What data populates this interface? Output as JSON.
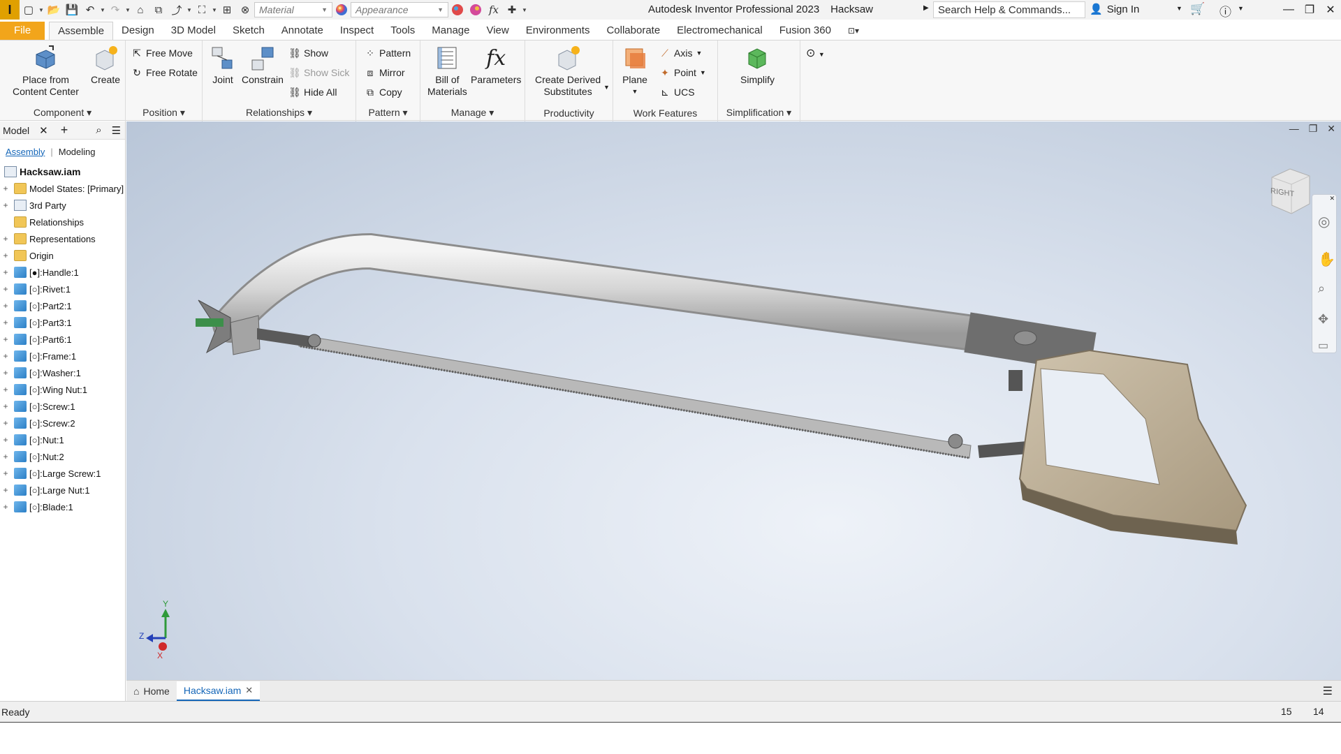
{
  "titlebar": {
    "app_name": "Autodesk Inventor Professional 2023",
    "document": "Hacksaw",
    "material_placeholder": "Material",
    "appearance_placeholder": "Appearance",
    "search_placeholder": "Search Help & Commands...",
    "sign_in": "Sign In"
  },
  "ribbon_tabs": [
    "File",
    "Assemble",
    "Design",
    "3D Model",
    "Sketch",
    "Annotate",
    "Inspect",
    "Tools",
    "Manage",
    "View",
    "Environments",
    "Collaborate",
    "Electromechanical",
    "Fusion 360"
  ],
  "active_tab": "Assemble",
  "ribbon": {
    "component": {
      "label": "Component",
      "place_line1": "Place from",
      "place_line2": "Content Center",
      "create": "Create"
    },
    "position": {
      "label": "Position",
      "free_move": "Free Move",
      "free_rotate": "Free Rotate"
    },
    "relationships": {
      "label": "Relationships",
      "joint": "Joint",
      "constrain": "Constrain",
      "show": "Show",
      "show_sick": "Show Sick",
      "hide_all": "Hide All"
    },
    "pattern": {
      "label": "Pattern",
      "pattern": "Pattern",
      "mirror": "Mirror",
      "copy": "Copy"
    },
    "manage": {
      "label": "Manage",
      "bom_line1": "Bill of",
      "bom_line2": "Materials",
      "parameters": "Parameters"
    },
    "productivity": {
      "label": "Productivity",
      "derived_line1": "Create Derived",
      "derived_line2": "Substitutes"
    },
    "work_features": {
      "label": "Work Features",
      "plane": "Plane",
      "axis": "Axis",
      "point": "Point",
      "ucs": "UCS"
    },
    "simplification": {
      "label": "Simplification",
      "simplify": "Simplify"
    }
  },
  "browser": {
    "panel_title": "Model",
    "subtab_assembly": "Assembly",
    "subtab_modeling": "Modeling",
    "root": "Hacksaw.iam",
    "items": [
      {
        "label": "Model States: [Primary]",
        "icon": "folder-icon",
        "expand": true
      },
      {
        "label": "3rd Party",
        "icon": "third-party-icon",
        "expand": true
      },
      {
        "label": "Relationships",
        "icon": "folder-icon",
        "expand": false
      },
      {
        "label": "Representations",
        "icon": "folder-icon",
        "expand": true
      },
      {
        "label": "Origin",
        "icon": "folder-icon",
        "expand": true
      },
      {
        "label": "[●]:Handle:1",
        "icon": "part-icon",
        "expand": true
      },
      {
        "label": "[○]:Rivet:1",
        "icon": "part-icon",
        "expand": true
      },
      {
        "label": "[○]:Part2:1",
        "icon": "part-icon",
        "expand": true
      },
      {
        "label": "[○]:Part3:1",
        "icon": "part-icon",
        "expand": true
      },
      {
        "label": "[○]:Part6:1",
        "icon": "part-icon",
        "expand": true
      },
      {
        "label": "[○]:Frame:1",
        "icon": "part-icon",
        "expand": true
      },
      {
        "label": "[○]:Washer:1",
        "icon": "part-icon",
        "expand": true
      },
      {
        "label": "[○]:Wing Nut:1",
        "icon": "part-icon",
        "expand": true
      },
      {
        "label": "[○]:Screw:1",
        "icon": "part-icon",
        "expand": true
      },
      {
        "label": "[○]:Screw:2",
        "icon": "part-icon",
        "expand": true
      },
      {
        "label": "[○]:Nut:1",
        "icon": "part-icon",
        "expand": true
      },
      {
        "label": "[○]:Nut:2",
        "icon": "part-icon",
        "expand": true
      },
      {
        "label": "[○]:Large Screw:1",
        "icon": "part-icon",
        "expand": true
      },
      {
        "label": "[○]:Large Nut:1",
        "icon": "part-icon",
        "expand": true
      },
      {
        "label": "[○]:Blade:1",
        "icon": "part-icon",
        "expand": true
      }
    ]
  },
  "viewcube": {
    "face": "RIGHT"
  },
  "triad": {
    "x": "X",
    "y": "Y",
    "z": "Z"
  },
  "doc_tabs": {
    "home": "Home",
    "active": "Hacksaw.iam"
  },
  "status": {
    "text": "Ready",
    "num1": "15",
    "num2": "14"
  },
  "colors": {
    "file_tab": "#f2a51b",
    "accent": "#1466b8",
    "handle": "#b3a58e"
  }
}
